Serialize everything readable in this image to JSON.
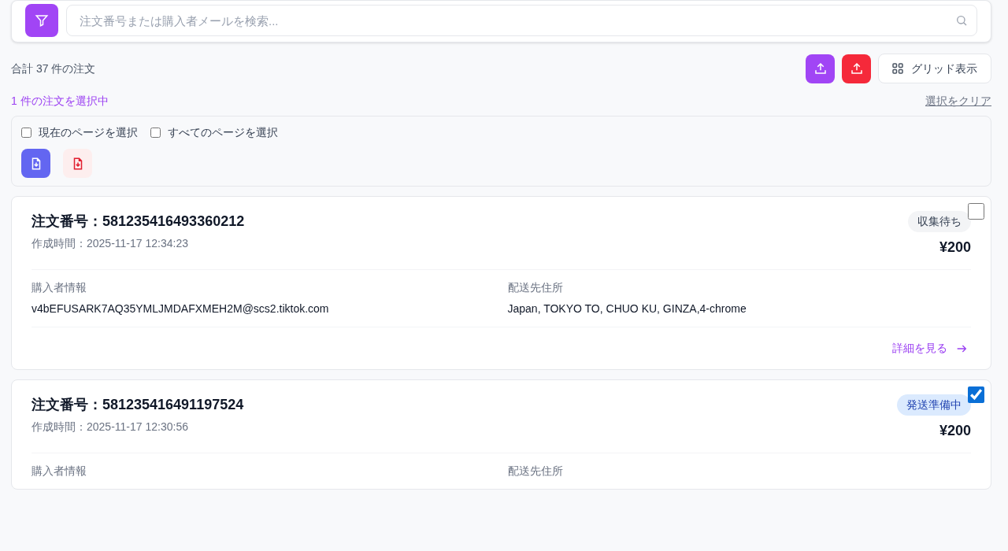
{
  "search": {
    "placeholder": "注文番号または購入者メールを検索..."
  },
  "summary": {
    "total": "合計 37 件の注文",
    "view_button": "グリッド表示"
  },
  "selection": {
    "count": "1 件の注文を選択中",
    "clear": "選択をクリア",
    "options": [
      {
        "label": "現在のページを選択",
        "checked": false
      },
      {
        "label": "すべてのページを選択",
        "checked": false
      }
    ]
  },
  "orders": [
    {
      "number": "注文番号：581235416493360212",
      "created": "作成時間：2025-11-17 12:34:23",
      "status": {
        "label": "収集待ち",
        "kind": "waiting"
      },
      "amount": "¥200",
      "checked": false,
      "buyer_label": "購入者情報",
      "buyer": "v4bEFUSARK7AQ35YMLJMDAFXMEH2M@scs2.tiktok.com",
      "address_label": "配送先住所",
      "address": "Japan, TOKYO TO, CHUO KU, GINZA,4-chrome",
      "details": "詳細を見る"
    },
    {
      "number": "注文番号：581235416491197524",
      "created": "作成時間：2025-11-17 12:30:56",
      "status": {
        "label": "発送準備中",
        "kind": "preparing"
      },
      "amount": "¥200",
      "checked": true,
      "buyer_label": "購入者情報",
      "address_label": "配送先住所"
    }
  ]
}
